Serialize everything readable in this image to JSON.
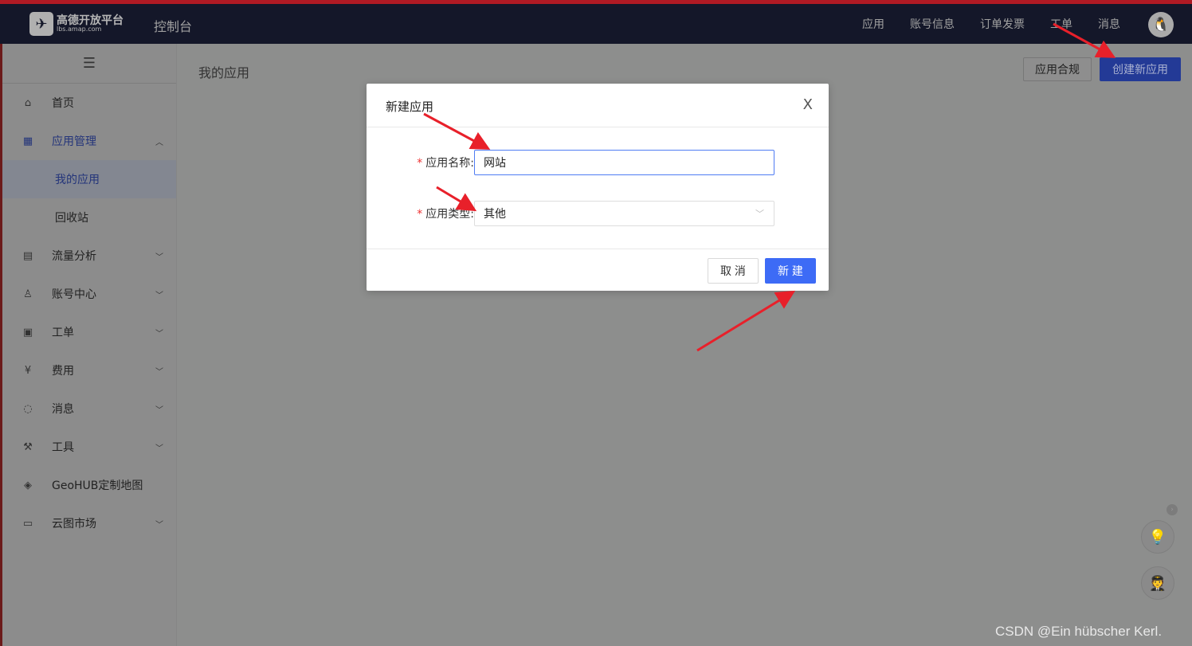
{
  "header": {
    "logo_name": "高德开放平台",
    "logo_url_text": "lbs.amap.com",
    "console": "控制台",
    "nav": [
      "应用",
      "账号信息",
      "订单发票",
      "工单",
      "消息"
    ]
  },
  "sidebar": {
    "toggle": "☰",
    "items": [
      {
        "label": "首页",
        "icon": "home-icon"
      },
      {
        "label": "应用管理",
        "icon": "grid-icon",
        "expanded": true
      },
      {
        "label": "我的应用",
        "sub": true,
        "active": true
      },
      {
        "label": "回收站",
        "sub": true
      },
      {
        "label": "流量分析",
        "icon": "chart-icon"
      },
      {
        "label": "账号中心",
        "icon": "user-icon"
      },
      {
        "label": "工单",
        "icon": "ticket-icon"
      },
      {
        "label": "费用",
        "icon": "yen-icon"
      },
      {
        "label": "消息",
        "icon": "message-icon"
      },
      {
        "label": "工具",
        "icon": "wrench-icon"
      },
      {
        "label": "GeoHUB定制地图",
        "icon": "layers-icon"
      },
      {
        "label": "云图市场",
        "icon": "store-icon"
      }
    ]
  },
  "main": {
    "title": "我的应用",
    "compliance_button": "应用合规",
    "create_button": "创建新应用"
  },
  "modal": {
    "title": "新建应用",
    "close": "X",
    "name_label": "应用名称:",
    "name_value": "网站",
    "type_label": "应用类型:",
    "type_value": "其他",
    "cancel": "取 消",
    "ok": "新 建",
    "required_mark": "*"
  },
  "watermark": "CSDN @Ein hübscher Kerl.",
  "colors": {
    "header_bg": "#141729",
    "primary": "#3d6bf6",
    "arrow": "#e8202a"
  }
}
